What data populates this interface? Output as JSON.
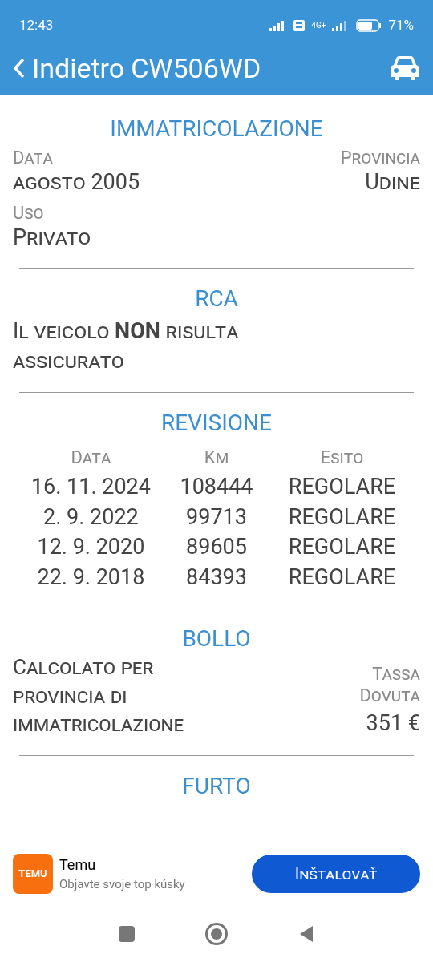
{
  "status_bar": {
    "time": "12:43",
    "network": "4G+",
    "battery": "71%"
  },
  "header": {
    "back_label": "Indietro",
    "title": "CW506WD"
  },
  "sections": [
    {
      "kind": "fields",
      "title": "IMMATRICOLAZIONE",
      "fields": [
        {
          "label": "Data",
          "value": "agosto 2005"
        },
        {
          "label": "Provincia",
          "value": "Udine"
        },
        {
          "label": "Uso",
          "value": "Privato"
        }
      ]
    },
    {
      "kind": "paragraph",
      "title": "RCA",
      "text": "Il veicolo **NON** risulta assicurato"
    },
    {
      "kind": "table",
      "title": "REVISIONE",
      "columns": [
        "Data",
        "Km",
        "Esito"
      ],
      "rows": [
        [
          "16. 11. 2024",
          "108444",
          "REGOLARE"
        ],
        [
          "2. 9. 2022",
          "99713",
          "REGOLARE"
        ],
        [
          "12. 9. 2020",
          "89605",
          "REGOLARE"
        ],
        [
          "22. 9. 2018",
          "84393",
          "REGOLARE"
        ]
      ]
    },
    {
      "kind": "tax",
      "title": "BOLLO",
      "text": "Calcolato per provincia di immatricolazione",
      "label": "Tassa Dovuta",
      "amount": "351 €"
    },
    {
      "kind": "heading",
      "title": "FURTO"
    }
  ],
  "ad": {
    "app_icon_text": "TEMU",
    "name": "Temu",
    "tagline": "Objavte svoje top kúsky",
    "button": "Inštalovať"
  }
}
